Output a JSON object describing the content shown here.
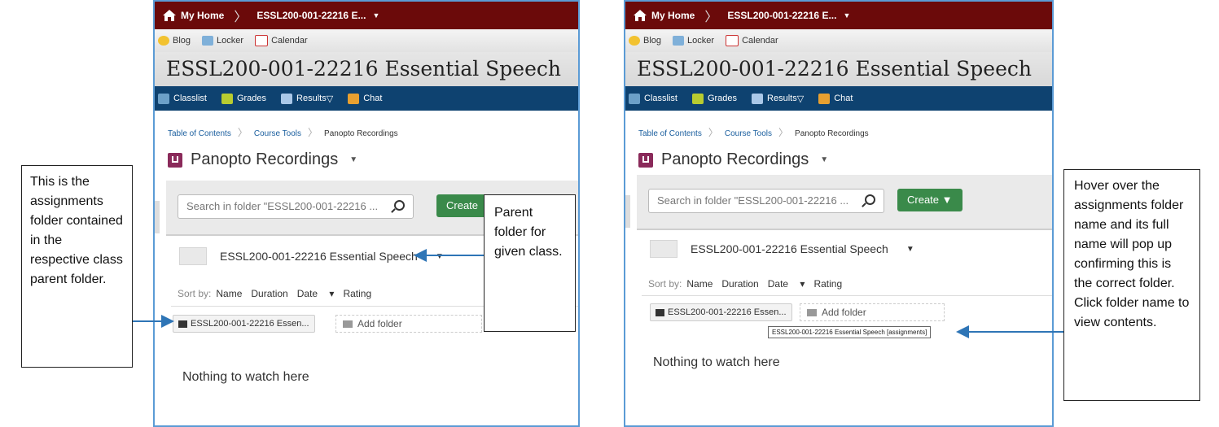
{
  "breadcrumb_top": {
    "home": "My Home",
    "course": "ESSL200-001-22216 E..."
  },
  "toolbar": {
    "blog": "Blog",
    "locker": "Locker",
    "calendar": "Calendar"
  },
  "course_title": "ESSL200-001-22216 Essential Speech",
  "nav": {
    "classlist": "Classlist",
    "grades": "Grades",
    "results": "Results",
    "chat": "Chat"
  },
  "crumbs": {
    "toc": "Table of Contents",
    "tools": "Course Tools",
    "current": "Panopto Recordings"
  },
  "page_title": "Panopto Recordings",
  "search_placeholder": "Search in folder \"ESSL200-001-22216 ...",
  "create_label": "Create",
  "parent_folder": "ESSL200-001-22216 Essential Speech",
  "sort": {
    "label": "Sort by:",
    "name": "Name",
    "duration": "Duration",
    "date": "Date",
    "rating": "Rating"
  },
  "subfolder_chip": "ESSL200-001-22216 Essen...",
  "add_folder": "Add folder",
  "empty_message": "Nothing to watch here",
  "tooltip": "ESSL200-001-22216 Essential Speech [assignments]",
  "callouts": {
    "left": "This is the assignments folder contained in the respective class parent folder.",
    "middle": "Parent folder for given class.",
    "right": "Hover over the assignments folder name and its full name will pop up confirming this is the correct folder.  Click folder name to view contents."
  },
  "colors": {
    "topbar": "#6b0a0a",
    "navbar": "#0e4270",
    "create": "#3a8a4a",
    "arrow": "#2e75b6"
  }
}
